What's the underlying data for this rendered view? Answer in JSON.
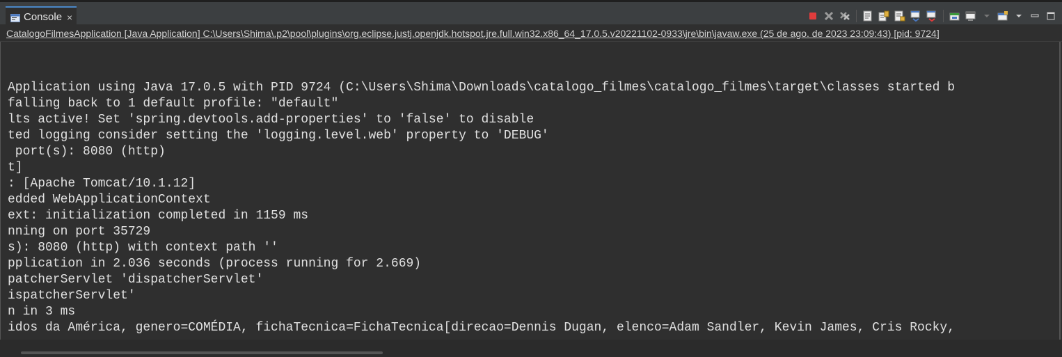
{
  "tab": {
    "label": "Console",
    "icon": "console-icon",
    "close_glyph": "×"
  },
  "toolbar": {
    "icons": [
      "terminate-icon",
      "remove-launch-icon",
      "remove-all-terminated-icon",
      "clear-console-icon",
      "scroll-lock-icon",
      "word-wrap-icon",
      "show-stdout-icon",
      "show-stderr-icon",
      "pin-console-icon",
      "display-selected-console-icon",
      "open-console-icon",
      "view-menu-icon",
      "minimize-icon",
      "maximize-icon"
    ]
  },
  "launch_path": "CatalogoFilmesApplication [Java Application] C:\\Users\\Shima\\.p2\\pool\\plugins\\org.eclipse.justj.openjdk.hotspot.jre.full.win32.x86_64_17.0.5.v20221102-0933\\jre\\bin\\javaw.exe  (25 de ago. de 2023 23:09:43) [pid: 9724]",
  "console_lines": [
    "Application using Java 17.0.5 with PID 9724 (C:\\Users\\Shima\\Downloads\\catalogo_filmes\\catalogo_filmes\\target\\classes started b",
    "falling back to 1 default profile: \"default\"",
    "lts active! Set 'spring.devtools.add-properties' to 'false' to disable",
    "ted logging consider setting the 'logging.level.web' property to 'DEBUG'",
    " port(s): 8080 (http)",
    "t]",
    ": [Apache Tomcat/10.1.12]",
    "edded WebApplicationContext",
    "ext: initialization completed in 1159 ms",
    "nning on port 35729",
    "s): 8080 (http) with context path ''",
    "pplication in 2.036 seconds (process running for 2.669)",
    "patcherServlet 'dispatcherServlet'",
    "ispatcherServlet'",
    "n in 3 ms",
    "idos da América, genero=COMÉDIA, fichaTecnica=FichaTecnica[direcao=Dennis Dugan, elenco=Adam Sandler, Kevin James, Cris Rocky,"
  ],
  "colors": {
    "background": "#2f2f2f",
    "text": "#e0e0e0",
    "terminate": "#e03c3c"
  }
}
